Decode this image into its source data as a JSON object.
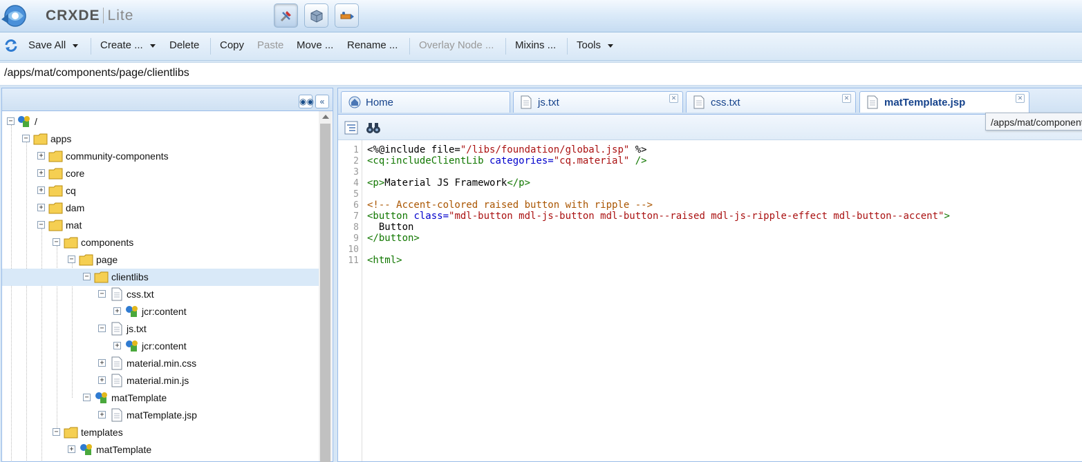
{
  "header": {
    "app_name": "CRXDE",
    "app_suffix": "Lite"
  },
  "toolbar": {
    "save_all": "Save All",
    "create": "Create ...",
    "delete": "Delete",
    "copy": "Copy",
    "paste": "Paste",
    "move": "Move ...",
    "rename": "Rename ...",
    "overlay_node": "Overlay Node ...",
    "mixins": "Mixins ...",
    "tools": "Tools"
  },
  "path": "/apps/mat/components/page/clientlibs",
  "tree": {
    "root": "/",
    "apps": "apps",
    "community_components": "community-components",
    "core": "core",
    "cq": "cq",
    "dam": "dam",
    "mat": "mat",
    "components": "components",
    "page": "page",
    "clientlibs": "clientlibs",
    "css_txt": "css.txt",
    "jcr_content_1": "jcr:content",
    "js_txt": "js.txt",
    "jcr_content_2": "jcr:content",
    "material_min_css": "material.min.css",
    "material_min_js": "material.min.js",
    "matTemplate": "matTemplate",
    "matTemplate_jsp": "matTemplate.jsp",
    "templates": "templates",
    "templates_matTemplate": "matTemplate"
  },
  "tabs": {
    "home": "Home",
    "js": "js.txt",
    "css": "css.txt",
    "mat": "matTemplate.jsp"
  },
  "tooltip": "/apps/mat/components/page/matTemplate.jsp",
  "code": {
    "line_numbers": [
      "1",
      "2",
      "3",
      "4",
      "5",
      "6",
      "7",
      "8",
      "9",
      "10",
      "11"
    ],
    "l1_a": "<%@include ",
    "l1_b": "file=",
    "l1_c": "\"/libs/foundation/global.jsp\"",
    "l1_d": " %>",
    "l2_a": "<cq:includeClientLib ",
    "l2_b": "categories=",
    "l2_c": "\"cq.material\"",
    "l2_d": " />",
    "l4_a": "<p>",
    "l4_b": "Material JS Framework",
    "l4_c": "</p>",
    "l6": "<!-- Accent-colored raised button with ripple -->",
    "l7_a": "<button ",
    "l7_b": "class=",
    "l7_c": "\"mdl-button mdl-js-button mdl-button--raised mdl-js-ripple-effect mdl-button--accent\"",
    "l7_d": ">",
    "l8": "  Button",
    "l9": "</button>",
    "l11": "<html>"
  }
}
